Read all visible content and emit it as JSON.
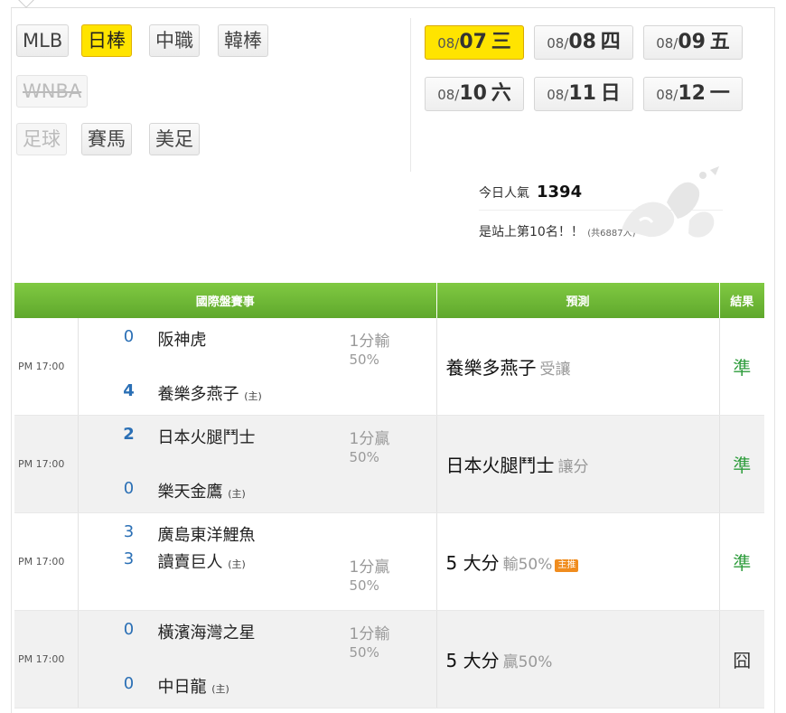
{
  "leagues": [
    {
      "label": "MLB",
      "state": "normal"
    },
    {
      "label": "日棒",
      "state": "active"
    },
    {
      "label": "中職",
      "state": "normal"
    },
    {
      "label": "韓棒",
      "state": "normal"
    },
    {
      "label": "WNBA",
      "state": "disabled-strike"
    },
    {
      "label": "足球",
      "state": "disabled"
    },
    {
      "label": "賽馬",
      "state": "normal"
    },
    {
      "label": "美足",
      "state": "normal"
    }
  ],
  "dates": [
    {
      "md": "08/",
      "day": "07",
      "wd": "三",
      "active": true
    },
    {
      "md": "08/",
      "day": "08",
      "wd": "四",
      "active": false
    },
    {
      "md": "08/",
      "day": "09",
      "wd": "五",
      "active": false
    },
    {
      "md": "08/",
      "day": "10",
      "wd": "六",
      "active": false
    },
    {
      "md": "08/",
      "day": "11",
      "wd": "日",
      "active": false
    },
    {
      "md": "08/",
      "day": "12",
      "wd": "一",
      "active": false
    }
  ],
  "popularity": {
    "today_label": "今日人氣",
    "today_count": "1394",
    "rank_text": "是站上第10名！！",
    "total_text": "(共6887人)"
  },
  "table": {
    "headers": [
      "國際盤賽事",
      "預測",
      "結果"
    ],
    "home_marker": "(主)",
    "rows": [
      {
        "time": "PM 17:00",
        "away_score": "0",
        "away_team": "阪神虎",
        "home_score": "4",
        "home_team": "養樂多燕子",
        "line": "1分輸",
        "pct": "50%",
        "pick": "養樂多燕子",
        "pick_sub": "受讓",
        "badge": "",
        "result": "準",
        "result_type": "win"
      },
      {
        "time": "PM 17:00",
        "away_score": "2",
        "away_team": "日本火腿鬥士",
        "home_score": "0",
        "home_team": "樂天金鷹",
        "line": "1分贏",
        "pct": "50%",
        "pick": "日本火腿鬥士",
        "pick_sub": "讓分",
        "badge": "",
        "result": "準",
        "result_type": "win"
      },
      {
        "time": "PM 17:00",
        "away_score": "3",
        "away_team": "廣島東洋鯉魚",
        "home_score": "3",
        "home_team": "讀賣巨人",
        "line": "1分贏",
        "pct": "50%",
        "pick": "5 大分",
        "pick_sub": "輸50%",
        "badge": "主推",
        "result": "準",
        "result_type": "win"
      },
      {
        "time": "PM 17:00",
        "away_score": "0",
        "away_team": "橫濱海灣之星",
        "home_score": "0",
        "home_team": "中日龍",
        "line": "1分輸",
        "pct": "50%",
        "pick": "5 大分",
        "pick_sub": "贏50%",
        "badge": "",
        "result": "囧",
        "result_type": "lose"
      }
    ]
  }
}
